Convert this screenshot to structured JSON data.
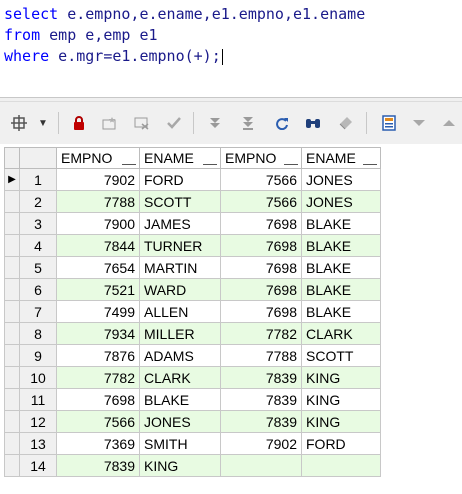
{
  "editor": {
    "lines": [
      {
        "kw": "select",
        "rest": " e.empno,e.ename,e1.empno,e1.ename"
      },
      {
        "kw": "from",
        "rest": " emp e,emp e1"
      },
      {
        "kw": "where",
        "rest": " e.mgr=e1.empno(+);"
      }
    ]
  },
  "toolbar": {
    "icons": [
      "grid-options-icon",
      "dropdown-arrow-icon",
      "lock-icon",
      "insert-record-icon",
      "delete-record-icon",
      "post-changes-icon",
      "first-record-icon",
      "last-record-icon",
      "refresh-icon",
      "find-icon",
      "clear-icon",
      "export-icon",
      "scroll-down-icon",
      "scroll-up-icon"
    ]
  },
  "grid": {
    "columns": [
      "EMPNO",
      "ENAME",
      "EMPNO",
      "ENAME"
    ],
    "rows": [
      {
        "n": "1",
        "empno": "7902",
        "ename": "FORD",
        "mgr_empno": "7566",
        "mgr_ename": "JONES"
      },
      {
        "n": "2",
        "empno": "7788",
        "ename": "SCOTT",
        "mgr_empno": "7566",
        "mgr_ename": "JONES"
      },
      {
        "n": "3",
        "empno": "7900",
        "ename": "JAMES",
        "mgr_empno": "7698",
        "mgr_ename": "BLAKE"
      },
      {
        "n": "4",
        "empno": "7844",
        "ename": "TURNER",
        "mgr_empno": "7698",
        "mgr_ename": "BLAKE"
      },
      {
        "n": "5",
        "empno": "7654",
        "ename": "MARTIN",
        "mgr_empno": "7698",
        "mgr_ename": "BLAKE"
      },
      {
        "n": "6",
        "empno": "7521",
        "ename": "WARD",
        "mgr_empno": "7698",
        "mgr_ename": "BLAKE"
      },
      {
        "n": "7",
        "empno": "7499",
        "ename": "ALLEN",
        "mgr_empno": "7698",
        "mgr_ename": "BLAKE"
      },
      {
        "n": "8",
        "empno": "7934",
        "ename": "MILLER",
        "mgr_empno": "7782",
        "mgr_ename": "CLARK"
      },
      {
        "n": "9",
        "empno": "7876",
        "ename": "ADAMS",
        "mgr_empno": "7788",
        "mgr_ename": "SCOTT"
      },
      {
        "n": "10",
        "empno": "7782",
        "ename": "CLARK",
        "mgr_empno": "7839",
        "mgr_ename": "KING"
      },
      {
        "n": "11",
        "empno": "7698",
        "ename": "BLAKE",
        "mgr_empno": "7839",
        "mgr_ename": "KING"
      },
      {
        "n": "12",
        "empno": "7566",
        "ename": "JONES",
        "mgr_empno": "7839",
        "mgr_ename": "KING"
      },
      {
        "n": "13",
        "empno": "7369",
        "ename": "SMITH",
        "mgr_empno": "7902",
        "mgr_ename": "FORD"
      },
      {
        "n": "14",
        "empno": "7839",
        "ename": "KING",
        "mgr_empno": "",
        "mgr_ename": ""
      }
    ]
  }
}
